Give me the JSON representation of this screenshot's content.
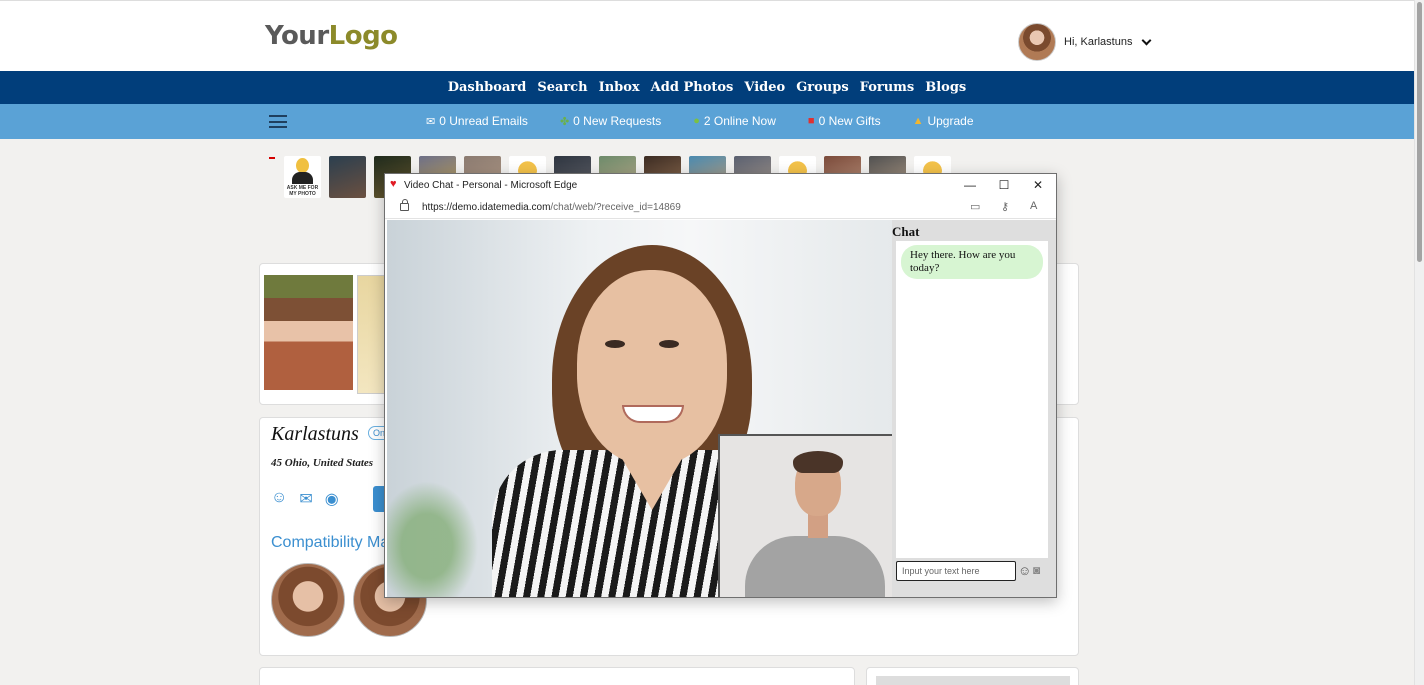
{
  "header": {
    "logo_part1": "Your",
    "logo_part2": "Logo",
    "greeting": "Hi, Karlastuns"
  },
  "main_nav": [
    "Dashboard",
    "Search",
    "Inbox",
    "Add Photos",
    "Video",
    "Groups",
    "Forums",
    "Blogs"
  ],
  "sub_nav": [
    {
      "icon": "envelope-icon",
      "label": "0 Unread Emails"
    },
    {
      "icon": "handshake-icon",
      "label": "0 New Requests"
    },
    {
      "icon": "person-online-icon",
      "label": "2 Online Now"
    },
    {
      "icon": "gift-icon",
      "label": "0 New Gifts"
    },
    {
      "icon": "upgrade-icon",
      "label": "Upgrade"
    }
  ],
  "thumb_strip": {
    "first_caption": "ASK ME FOR MY PHOTO"
  },
  "profile": {
    "name": "Karlastuns",
    "status": "Onl",
    "location": "45 Ohio, United States",
    "compat_heading": "Compatibility Ma"
  },
  "popup": {
    "title": "Video Chat - Personal - Microsoft Edge",
    "url_host": "https://demo.idatemedia.com",
    "url_path": "/chat/web/?receive_id=14869",
    "chat_heading": "Chat",
    "message": "Hey there. How are you today?",
    "input_placeholder": "Input your text here"
  },
  "colors": {
    "nav_dark": "#013e7b",
    "nav_light": "#5aa2d6",
    "accent_blue": "#3b8fd0",
    "logo_gold": "#8c8a2a",
    "chat_bubble": "#d7f5d2"
  }
}
